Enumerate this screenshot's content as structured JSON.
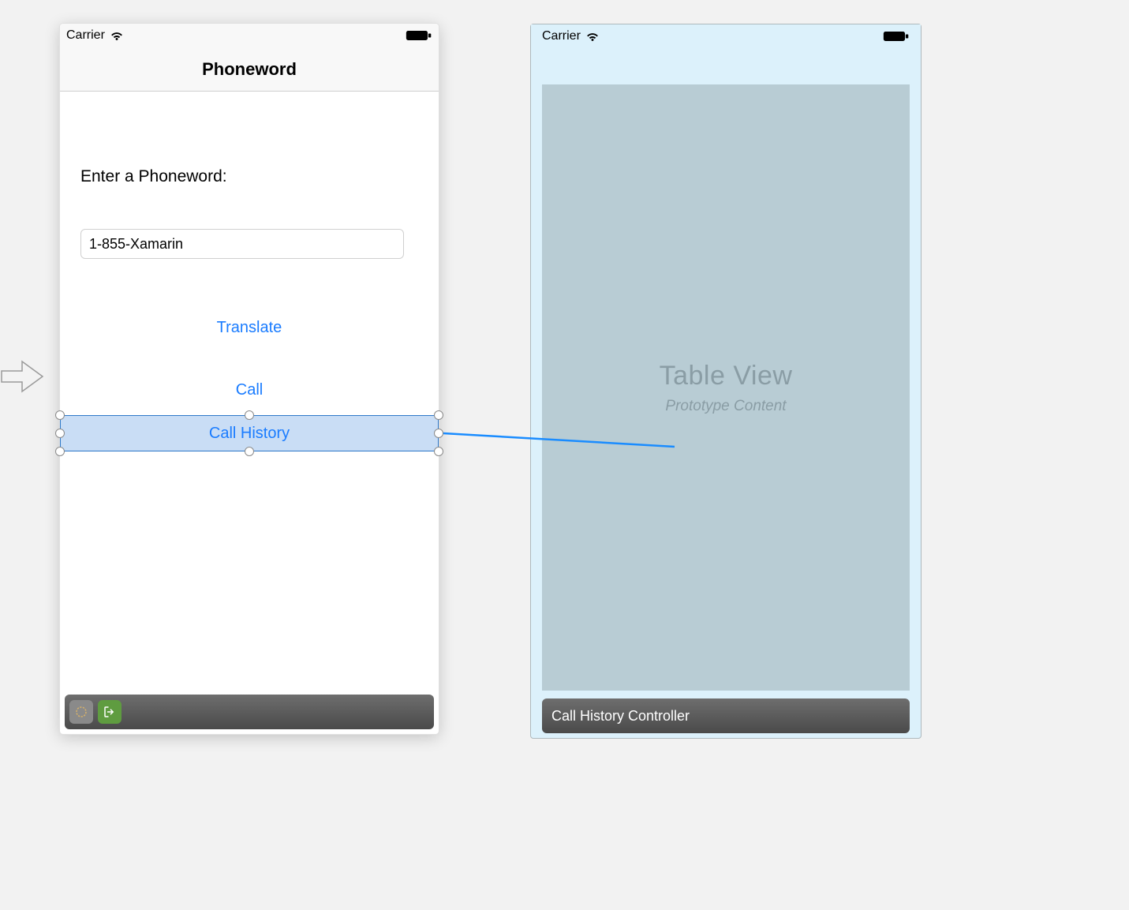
{
  "left_scene": {
    "status": {
      "carrier": "Carrier"
    },
    "nav": {
      "title": "Phoneword"
    },
    "prompt": "Enter a Phoneword:",
    "input_value": "1-855-Xamarin",
    "buttons": {
      "translate": "Translate",
      "call": "Call",
      "call_history": "Call History"
    }
  },
  "right_scene": {
    "status": {
      "carrier": "Carrier"
    },
    "tableview": {
      "title": "Table View",
      "subtitle": "Prototype Content"
    },
    "scene_label": "Call History Controller"
  }
}
